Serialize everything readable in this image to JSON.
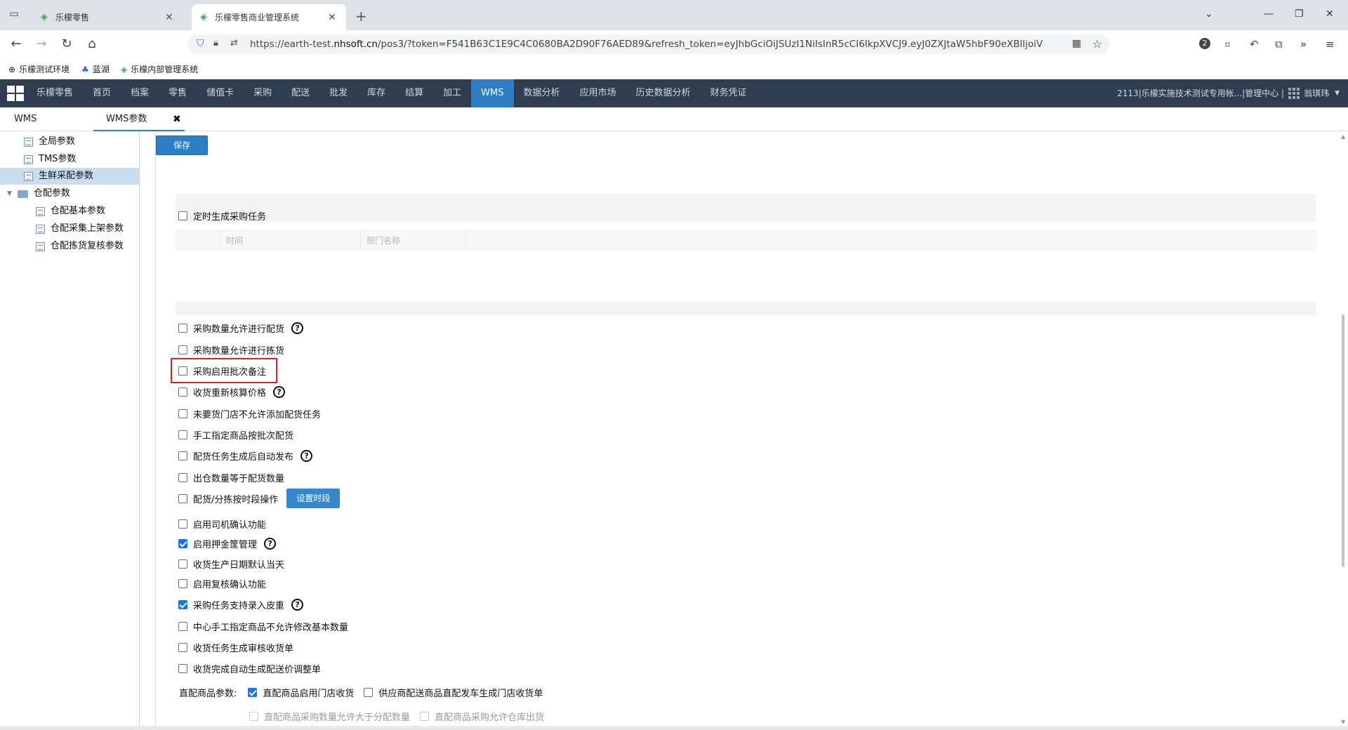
{
  "browser": {
    "tabs": [
      {
        "title": "乐檬零售"
      },
      {
        "title": "乐檬零售商业管理系统"
      }
    ],
    "url_prefix": "https://earth-test.",
    "url_domain": "nhsoft.cn",
    "url_rest": "/pos3/?token=F541B63C1E9C4C0680BA2D90F76AED89&refresh_token=eyJhbGciOiJSUzI1NiIsInR5cCI6IkpXVCJ9.eyJ0ZXJtaW5hbF90eXBlIjoiV0VCIiwi",
    "extension_badge": "2",
    "bookmarks": [
      {
        "label": "乐檬测试环境",
        "icon": "globe-icon"
      },
      {
        "label": "蓝湖",
        "icon": "lanhu-icon"
      },
      {
        "label": "乐檬内部管理系统",
        "icon": "lemeng-icon"
      }
    ]
  },
  "app": {
    "menu": [
      "乐檬零售",
      "首页",
      "档案",
      "零售",
      "储值卡",
      "采购",
      "配送",
      "批发",
      "库存",
      "结算",
      "加工",
      "WMS",
      "数据分析",
      "应用市场",
      "历史数据分析",
      "财务凭证"
    ],
    "active_menu": "WMS",
    "account": "2113|乐檬实施技术测试专用帐...|管理中心 |",
    "user": "翁琪玮"
  },
  "page_tabs": [
    {
      "label": "WMS"
    },
    {
      "label": "WMS参数"
    }
  ],
  "sidebar": {
    "items": [
      {
        "label": "全局参数",
        "type": "doc",
        "level": 1
      },
      {
        "label": "TMS参数",
        "type": "doc",
        "level": 1
      },
      {
        "label": "生鲜采配参数",
        "type": "doc",
        "level": 1,
        "selected": true
      },
      {
        "label": "仓配参数",
        "type": "folder",
        "level": 0,
        "expanded": true
      },
      {
        "label": "仓配基本参数",
        "type": "doc",
        "level": 2
      },
      {
        "label": "仓配采集上架参数",
        "type": "doc",
        "level": 2
      },
      {
        "label": "仓配拣货复核参数",
        "type": "doc",
        "level": 2
      }
    ]
  },
  "main": {
    "save_label": "保存",
    "timed_purchase": {
      "label": "定时生成采购任务",
      "checked": false
    },
    "subtable": {
      "columns": [
        "时间",
        "部门名称"
      ]
    },
    "options": [
      {
        "label": "采购数量允许进行配货",
        "checked": false,
        "help": true
      },
      {
        "label": "采购数量允许进行拣货",
        "checked": false,
        "help": false
      },
      {
        "label": "采购启用批次备注",
        "checked": false,
        "help": false,
        "highlighted": true
      },
      {
        "label": "收货重新核算价格",
        "checked": false,
        "help": true
      },
      {
        "label": "未要货门店不允许添加配货任务",
        "checked": false,
        "help": false
      },
      {
        "label": "手工指定商品按批次配货",
        "checked": false,
        "help": false
      },
      {
        "label": "配货任务生成后自动发布",
        "checked": false,
        "help": true
      },
      {
        "label": "出仓数量等于配货数量",
        "checked": false,
        "help": false
      },
      {
        "label": "配货/分拣按时段操作",
        "checked": false,
        "help": false,
        "button": "设置时段"
      },
      {
        "label": "启用司机确认功能",
        "checked": false,
        "help": false
      },
      {
        "label": "启用押金筐管理",
        "checked": true,
        "help": true
      },
      {
        "label": "收货生产日期默认当天",
        "checked": false,
        "help": false
      },
      {
        "label": "启用复核确认功能",
        "checked": false,
        "help": false
      },
      {
        "label": "采购任务支持录入皮重",
        "checked": true,
        "help": true
      },
      {
        "label": "中心手工指定商品不允许修改基本数量",
        "checked": false,
        "help": false
      },
      {
        "label": "收货任务生成审核收货单",
        "checked": false,
        "help": false
      },
      {
        "label": "收货完成自动生成配送价调整单",
        "checked": false,
        "help": false
      }
    ],
    "direct": {
      "label": "直配商品参数:",
      "opt1": {
        "label": "直配商品启用门店收货",
        "checked": true
      },
      "opt2": {
        "label": "供应商配送商品直配发车生成门店收货单",
        "checked": false
      },
      "opt3": {
        "label": "直配商品采购数量允许大于分配数量",
        "checked": false,
        "disabled": true
      },
      "opt4": {
        "label": "直配商品采购允许仓库出货",
        "checked": false,
        "disabled": true
      }
    },
    "help_glyph": "?"
  }
}
